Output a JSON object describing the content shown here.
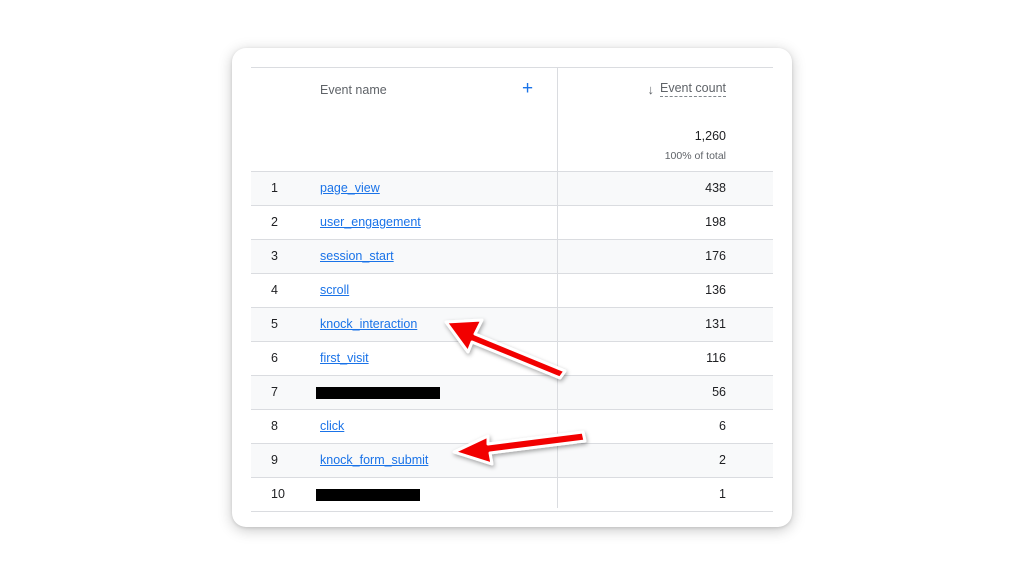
{
  "table": {
    "header": {
      "event_name_label": "Event name",
      "add_label": "+",
      "sort_arrow": "↓",
      "event_count_label": "Event count",
      "total_value": "1,260",
      "total_pct": "100% of total"
    },
    "rows": [
      {
        "index": "1",
        "name": "page_view",
        "count": "438"
      },
      {
        "index": "2",
        "name": "user_engagement",
        "count": "198"
      },
      {
        "index": "3",
        "name": "session_start",
        "count": "176"
      },
      {
        "index": "4",
        "name": "scroll",
        "count": "136"
      },
      {
        "index": "5",
        "name": "knock_interaction",
        "count": "131"
      },
      {
        "index": "6",
        "name": "first_visit",
        "count": "116"
      },
      {
        "index": "7",
        "name": "",
        "count": "56",
        "redacted": true
      },
      {
        "index": "8",
        "name": "click",
        "count": "6"
      },
      {
        "index": "9",
        "name": "knock_form_submit",
        "count": "2"
      },
      {
        "index": "10",
        "name": "",
        "count": "1",
        "redacted": true
      }
    ]
  },
  "colors": {
    "link": "#1a73e8",
    "annotation_arrow": "#f20000",
    "redaction": "#000000"
  }
}
